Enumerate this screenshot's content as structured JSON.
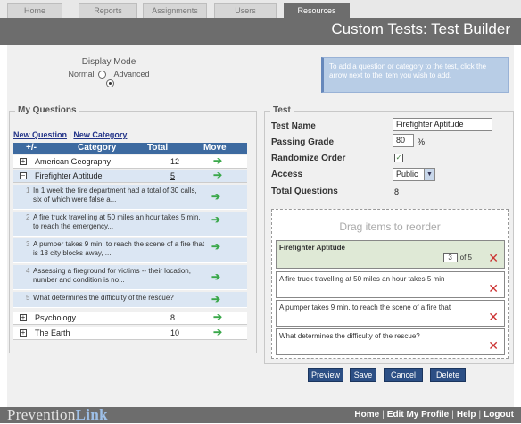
{
  "tabs": [
    "Home",
    "Reports",
    "Assignments",
    "Users",
    "Resources"
  ],
  "header": {
    "title": "Custom Tests: Test Builder"
  },
  "display_mode": {
    "title": "Display Mode",
    "normal": "Normal",
    "advanced": "Advanced",
    "selected": "Advanced"
  },
  "info": {
    "text": "To add a question or category to the test, click the arrow next to the item you wish to add."
  },
  "my_questions": {
    "title": "My Questions",
    "new_question": "New Question",
    "separator": "|",
    "new_category": "New Category",
    "columns": [
      "+/-",
      "Category",
      "Total",
      "Move"
    ],
    "categories": [
      {
        "expander": "+",
        "name": "American Geography",
        "total": "12"
      },
      {
        "expander": "−",
        "name": "Firefighter Aptitude",
        "total": "5"
      },
      {
        "expander": "+",
        "name": "Psychology",
        "total": "8"
      },
      {
        "expander": "+",
        "name": "The Earth",
        "total": "10"
      }
    ],
    "questions": [
      {
        "num": "1",
        "text": "In 1 week the fire department had a total of 30 calls, six of which were false a..."
      },
      {
        "num": "2",
        "text": "A fire truck travelling at 50 miles an hour takes 5 min. to reach the emergency..."
      },
      {
        "num": "3",
        "text": "A pumper takes 9 min. to reach the scene of a fire that is 18 city blocks away, ..."
      },
      {
        "num": "4",
        "text": "Assessing a fireground for victims -- their location, number and condition is no..."
      },
      {
        "num": "5",
        "text": "What determines the difficulty of the rescue?"
      }
    ]
  },
  "test": {
    "title": "Test",
    "name_label": "Test Name",
    "name_value": "Firefighter Aptitude",
    "grade_label": "Passing Grade",
    "grade_value": "80",
    "grade_unit": "%",
    "randomize_label": "Randomize Order",
    "randomize_checked": "☑",
    "access_label": "Access",
    "access_value": "Public",
    "total_label": "Total Questions",
    "total_value": "8",
    "drag_title": "Drag items to reorder",
    "items": [
      {
        "text": "Firefighter Aptitude",
        "order": "3",
        "of": "of 5"
      },
      {
        "text": "A fire truck travelling at 50 miles an hour takes 5 min"
      },
      {
        "text": "A pumper takes 9 min. to reach the scene of a fire that"
      },
      {
        "text": "What determines the difficulty of the rescue?"
      }
    ]
  },
  "buttons": {
    "preview": "Preview",
    "save": "Save",
    "cancel": "Cancel",
    "delete": "Delete"
  },
  "footer": {
    "logo_a": "Prevention",
    "logo_b": "Link",
    "home": "Home",
    "edit_profile": "Edit My Profile",
    "help": "Help",
    "logout": "Logout",
    "sep": "|"
  },
  "icons": {
    "move": "right-arrow-icon",
    "remove": "close-x-icon"
  },
  "colors": {
    "header": "#6d6d6d",
    "grid_header": "#3d6aa0",
    "button": "#2c4f85",
    "arrow": "#3aa84a",
    "remove": "#cc3333"
  }
}
